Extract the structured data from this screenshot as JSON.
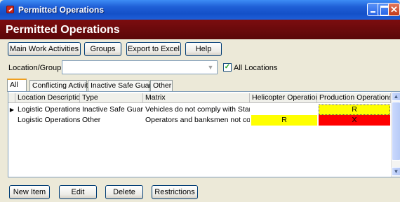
{
  "window": {
    "title": "Permitted Operations"
  },
  "header": {
    "title": "Permitted Operations"
  },
  "toolbar": {
    "main_work_activities": "Main Work Activities",
    "groups": "Groups",
    "export_to_excel": "Export to Excel",
    "help": "Help"
  },
  "filter": {
    "location_label": "Location/Group",
    "location_value": "",
    "all_locations_label": "All Locations",
    "all_locations_checked": true
  },
  "tabs": [
    {
      "label": "All",
      "active": true
    },
    {
      "label": "Conflicting Activity",
      "active": false
    },
    {
      "label": "Inactive Safe Guard",
      "active": false
    },
    {
      "label": "Other",
      "active": false
    }
  ],
  "grid": {
    "columns": [
      "Location Description",
      "Type",
      "Matrix",
      "Helicopter Operations",
      "Production Operations"
    ],
    "rows": [
      {
        "selected": true,
        "cells": [
          "Logistic Operations",
          "Inactive Safe Guard",
          "Vehicles do not comply with Standar",
          "",
          "R"
        ],
        "colors": [
          "",
          "",
          "",
          "#ffffff",
          "#ffff00"
        ]
      },
      {
        "selected": false,
        "cells": [
          "Logistic Operations",
          "Other",
          "Operators and banksmen not compe",
          "R",
          "X"
        ],
        "colors": [
          "",
          "",
          "",
          "#ffff00",
          "#ff0000"
        ]
      }
    ]
  },
  "bottom_buttons": {
    "new_item": "New Item",
    "edit": "Edit",
    "delete": "Delete",
    "restrictions": "Restrictions"
  },
  "colors": {
    "header_band": "#6b0a0c",
    "titlebar": "#1f5fd6",
    "cell_yellow": "#ffff00",
    "cell_red": "#ff0000"
  }
}
